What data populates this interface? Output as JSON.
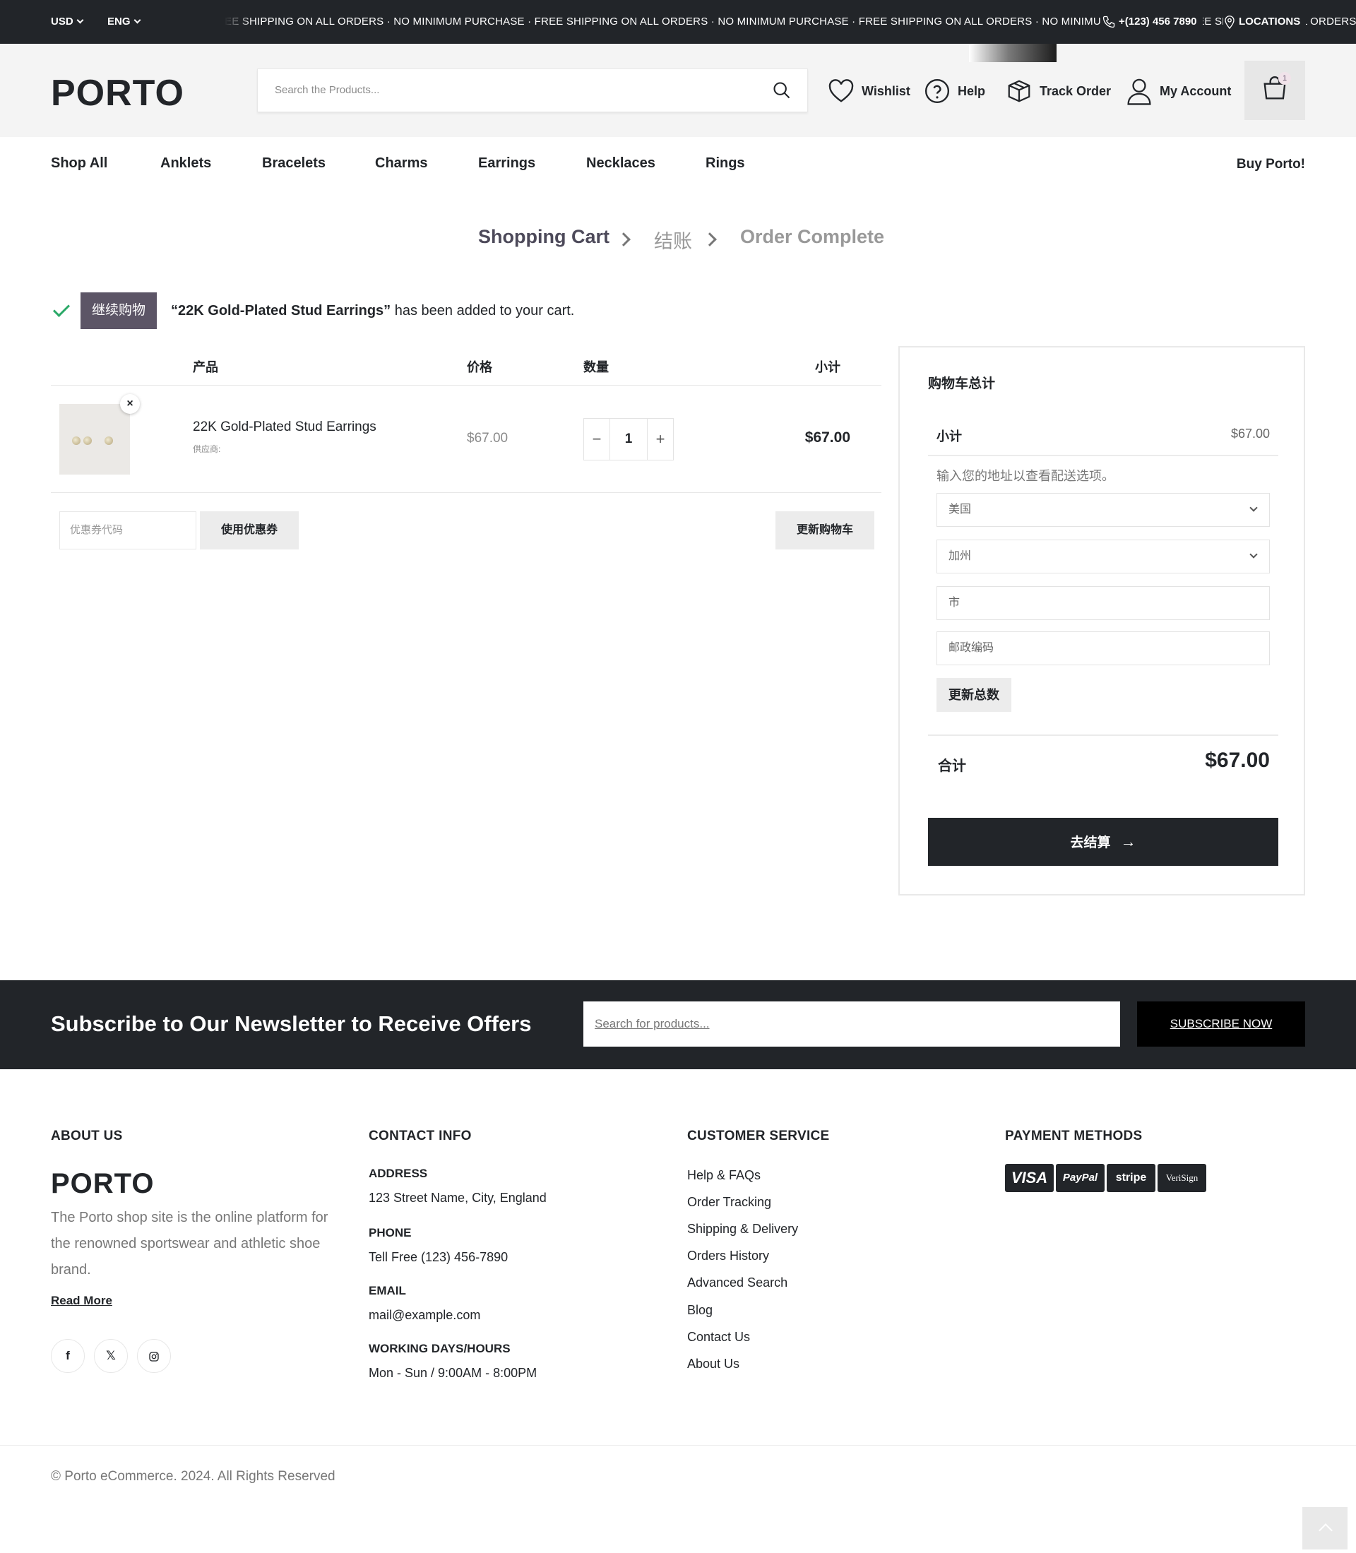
{
  "topbar": {
    "currency": "USD",
    "language": "ENG",
    "marquee": "EE SHIPPING ON ALL ORDERS · NO MINIMUM PURCHASE · FREE SHIPPING ON ALL ORDERS · NO MINIMUM PURCHASE · FREE SHIPPING ON ALL ORDERS · NO MINIMUM PURCHASE · FREE SHIPPING ON ALL ORDERS · NO MI",
    "phone": "+(123) 456 7890",
    "locations": "LOCATIONS",
    "icons": [
      "phone-icon",
      "location-pin-icon"
    ]
  },
  "header": {
    "logo": "PORTO",
    "search_placeholder": "Search the Products...",
    "wishlist": "Wishlist",
    "help": "Help",
    "track_order": "Track Order",
    "my_account": "My Account",
    "cart_count": "1",
    "icons": [
      "search-icon",
      "heart-icon",
      "help-icon",
      "box-icon",
      "user-icon",
      "bag-icon"
    ]
  },
  "nav": {
    "items": [
      "Shop All",
      "Anklets",
      "Bracelets",
      "Charms",
      "Earrings",
      "Necklaces",
      "Rings"
    ],
    "buy": "Buy Porto!"
  },
  "steps": {
    "cart": "Shopping Cart",
    "checkout": "结账",
    "complete": "Order Complete"
  },
  "notice": {
    "continue_button": "继续购物",
    "product_quoted": "“22K Gold-Plated Stud Earrings”",
    "message": " has been added to your cart."
  },
  "cart": {
    "columns": {
      "product": "产品",
      "price": "价格",
      "quantity": "数量",
      "subtotal": "小计"
    },
    "items": [
      {
        "name": "22K Gold-Plated Stud Earrings",
        "vendor_label": "供应商:",
        "price": "$67.00",
        "quantity": "1",
        "subtotal": "$67.00"
      }
    ],
    "coupon_placeholder": "优惠券代码",
    "apply_coupon": "使用优惠券",
    "update_cart": "更新购物车"
  },
  "totals": {
    "title": "购物车总计",
    "subtotal_label": "小计",
    "subtotal_value": "$67.00",
    "shipping_hint": "输入您的地址以查看配送选项。",
    "country": "美国",
    "state": "加州",
    "city_placeholder": "市",
    "zip_placeholder": "邮政编码",
    "update_totals": "更新总数",
    "total_label": "合计",
    "total_value": "$67.00",
    "checkout": "去结算"
  },
  "newsletter": {
    "title": "Subscribe to Our Newsletter to Receive Offers",
    "placeholder": "Search for products...",
    "button": "SUBSCRIBE NOW"
  },
  "footer": {
    "about": {
      "heading": "ABOUT US",
      "logo": "PORTO",
      "text": "The Porto shop site is the online platform for the renowned sportswear and athletic shoe brand.",
      "read_more": "Read More",
      "social": [
        "facebook-icon",
        "x-icon",
        "instagram-icon"
      ]
    },
    "contact": {
      "heading": "CONTACT INFO",
      "address_label": "ADDRESS",
      "address": "123 Street Name, City, England",
      "phone_label": "PHONE",
      "phone": "Tell Free (123) 456-7890",
      "email_label": "EMAIL",
      "email": "mail@example.com",
      "hours_label": "WORKING DAYS/HOURS",
      "hours": "Mon - Sun / 9:00AM - 8:00PM"
    },
    "service": {
      "heading": "CUSTOMER SERVICE",
      "links": [
        "Help & FAQs",
        "Order Tracking",
        "Shipping & Delivery",
        "Orders History",
        "Advanced Search",
        "Blog",
        "Contact Us",
        "About Us"
      ]
    },
    "payment": {
      "heading": "PAYMENT METHODS",
      "methods": [
        "VISA",
        "PayPal",
        "stripe",
        "VeriSign"
      ]
    },
    "copyright": "© Porto eCommerce. 2024. All Rights Reserved"
  },
  "colors": {
    "dark": "#222529",
    "accent_purple": "#5c5566",
    "check_green": "#2ba968",
    "light_gray": "#f4f4f4"
  }
}
